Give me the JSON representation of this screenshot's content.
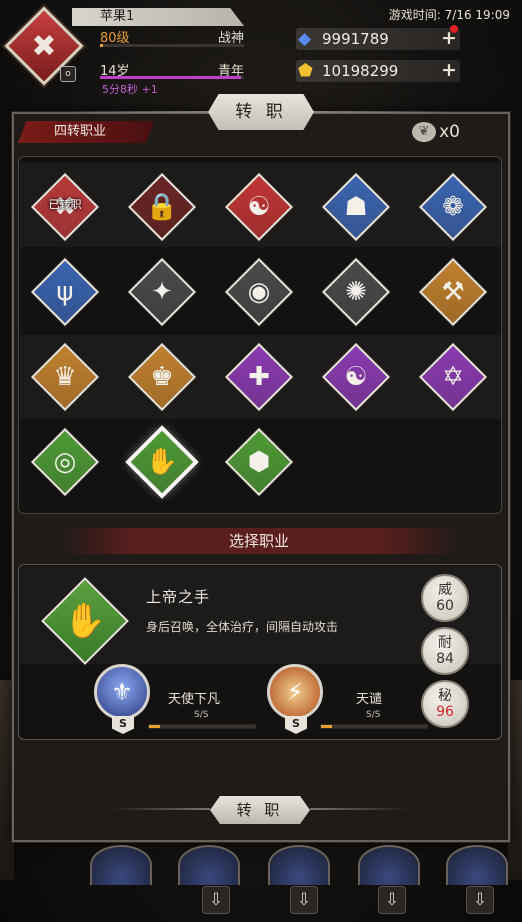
{
  "hud": {
    "player_name": "苹果1",
    "level": "80级",
    "title": "战神",
    "age": "14岁",
    "life_stage": "青年",
    "timer": "5分8秒 +1",
    "game_time": "游戏时间: 7/16 19:09",
    "avatar_badge": "o",
    "currencies": [
      {
        "icon": "diamond-icon",
        "value": "9991789",
        "color": "#4a7ae0"
      },
      {
        "icon": "gold-gem-icon",
        "value": "10198299",
        "color": "#e8b020"
      }
    ],
    "level_progress": 0.02,
    "age_progress": 0.98
  },
  "panel": {
    "title": "转 职",
    "tier": "四转职业",
    "feather_count": "x0"
  },
  "jobs": [
    {
      "icon": "crossed-axes-icon",
      "glyph": "✖",
      "color": "#b83a3a",
      "overlay": "已转职"
    },
    {
      "icon": "lock-icon",
      "glyph": "🔒",
      "color": "#6a2424",
      "overlay": ""
    },
    {
      "icon": "triskelion-icon",
      "glyph": "☯",
      "color": "#c03434",
      "overlay": ""
    },
    {
      "icon": "demon-mask-icon",
      "glyph": "☗",
      "color": "#3a64b0",
      "overlay": ""
    },
    {
      "icon": "dragon-icon",
      "glyph": "❁",
      "color": "#3a64b0",
      "overlay": ""
    },
    {
      "icon": "trident-icon",
      "glyph": "ψ",
      "color": "#3a64b0",
      "overlay": ""
    },
    {
      "icon": "sword-burst-icon",
      "glyph": "✦",
      "color": "#4a4a4a",
      "overlay": ""
    },
    {
      "icon": "eye-burst-icon",
      "glyph": "◉",
      "color": "#4a4a4a",
      "overlay": ""
    },
    {
      "icon": "spider-icon",
      "glyph": "✺",
      "color": "#4a4a4a",
      "overlay": ""
    },
    {
      "icon": "axe-banner-icon",
      "glyph": "⚒",
      "color": "#c0802e",
      "overlay": ""
    },
    {
      "icon": "crown-skull-icon",
      "glyph": "♛",
      "color": "#c0802e",
      "overlay": ""
    },
    {
      "icon": "crown-chain-icon",
      "glyph": "♚",
      "color": "#c0802e",
      "overlay": ""
    },
    {
      "icon": "gear-cross-icon",
      "glyph": "✚",
      "color": "#8a3ab0",
      "overlay": ""
    },
    {
      "icon": "yin-yang-icon",
      "glyph": "☯",
      "color": "#8a3ab0",
      "overlay": ""
    },
    {
      "icon": "hexagram-icon",
      "glyph": "✡",
      "color": "#8a3ab0",
      "overlay": ""
    },
    {
      "icon": "eye-sun-icon",
      "glyph": "◎",
      "color": "#4e9a36",
      "overlay": ""
    },
    {
      "icon": "hand-icon",
      "glyph": "✋",
      "color": "#4e9a36",
      "overlay": "",
      "selected": true
    },
    {
      "icon": "cube-icon",
      "glyph": "⬢",
      "color": "#4e9a36",
      "overlay": ""
    }
  ],
  "select": {
    "header": "选择职业",
    "job_name": "上帝之手",
    "job_desc": "身后召唤，全体治疗，间隔自动攻击",
    "job_icon": "hand-icon",
    "stats": [
      {
        "key": "威",
        "value": "60",
        "highlight": false
      },
      {
        "key": "耐",
        "value": "84",
        "highlight": false
      },
      {
        "key": "秘",
        "value": "96",
        "highlight": true
      }
    ],
    "skills": [
      {
        "icon": "angel-wings-icon",
        "name": "天使下凡",
        "grade": "S",
        "level": "S/S",
        "progress": 0.1,
        "color": "#3a5ab0"
      },
      {
        "icon": "light-pillar-icon",
        "name": "天谴",
        "grade": "S",
        "level": "S/S",
        "progress": 0.1,
        "color": "#d06a28"
      }
    ],
    "button": "转 职"
  }
}
